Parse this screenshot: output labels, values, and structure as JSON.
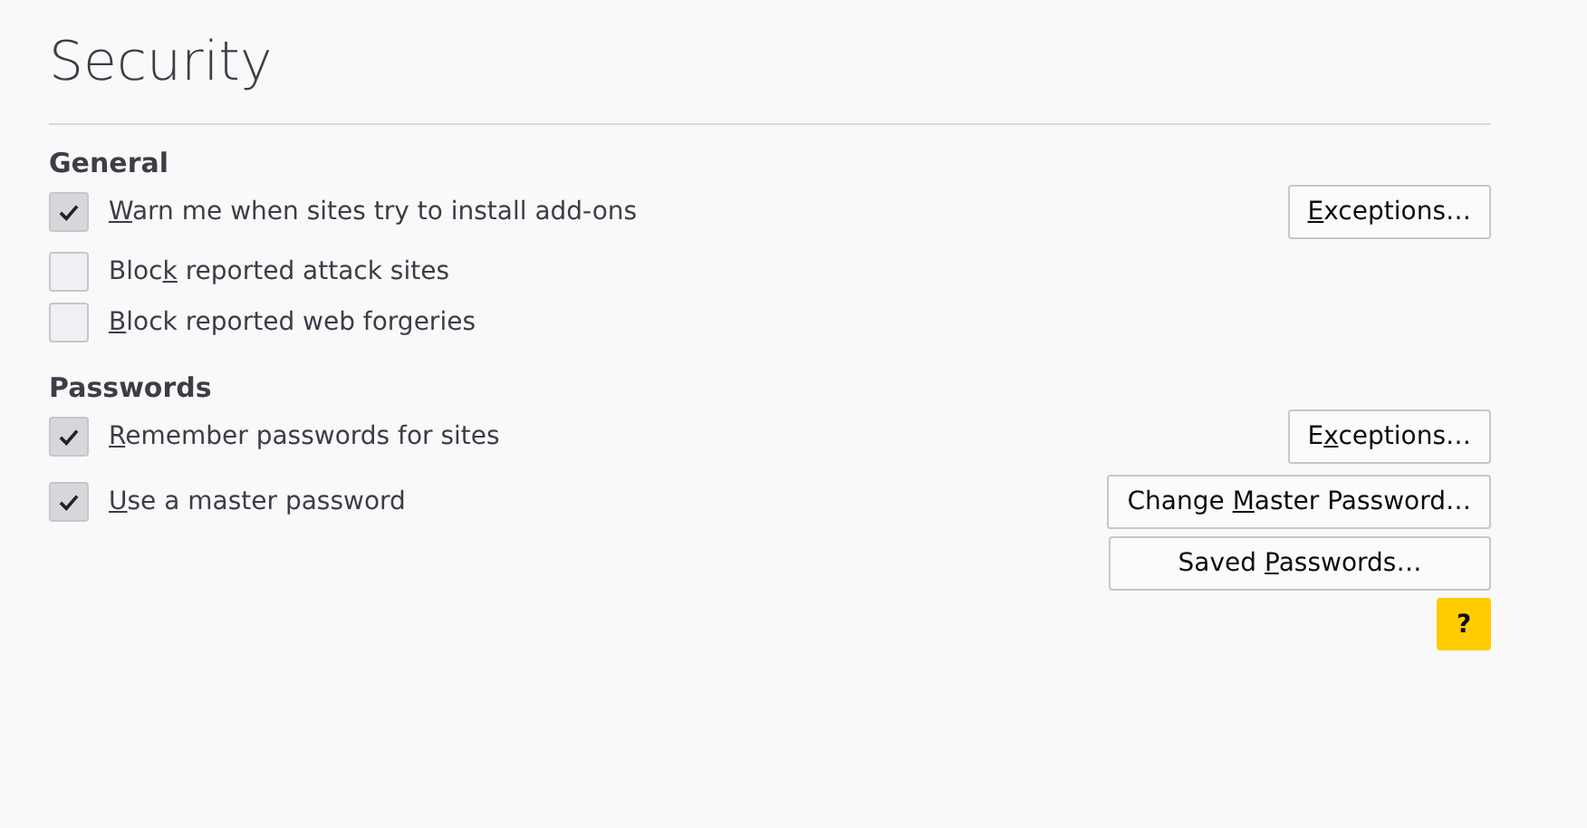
{
  "page": {
    "title": "Security"
  },
  "sections": [
    {
      "heading": "General",
      "rows": [
        {
          "label": {
            "key": "W",
            "after": "arn me when sites try to install add-ons"
          },
          "checked": true,
          "buttons": [
            {
              "key": "E",
              "after": "xceptions…"
            }
          ]
        },
        {
          "label": {
            "before": "Bloc",
            "key": "k",
            "after": " reported attack sites"
          },
          "checked": false,
          "buttons": []
        },
        {
          "label": {
            "key": "B",
            "after": "lock reported web forgeries"
          },
          "checked": false,
          "buttons": []
        }
      ]
    },
    {
      "heading": "Passwords",
      "rows": [
        {
          "label": {
            "key": "R",
            "after": "emember passwords for sites"
          },
          "checked": true,
          "buttons": [
            {
              "before": "E",
              "key": "x",
              "after": "ceptions…"
            }
          ]
        },
        {
          "label": {
            "key": "U",
            "after": "se a master password"
          },
          "checked": true,
          "buttons": [
            {
              "before": "Change ",
              "key": "M",
              "after": "aster Password…"
            },
            {
              "before": "Saved ",
              "key": "P",
              "after": "asswords…"
            }
          ]
        }
      ]
    }
  ],
  "help_button": {
    "label": "?"
  }
}
